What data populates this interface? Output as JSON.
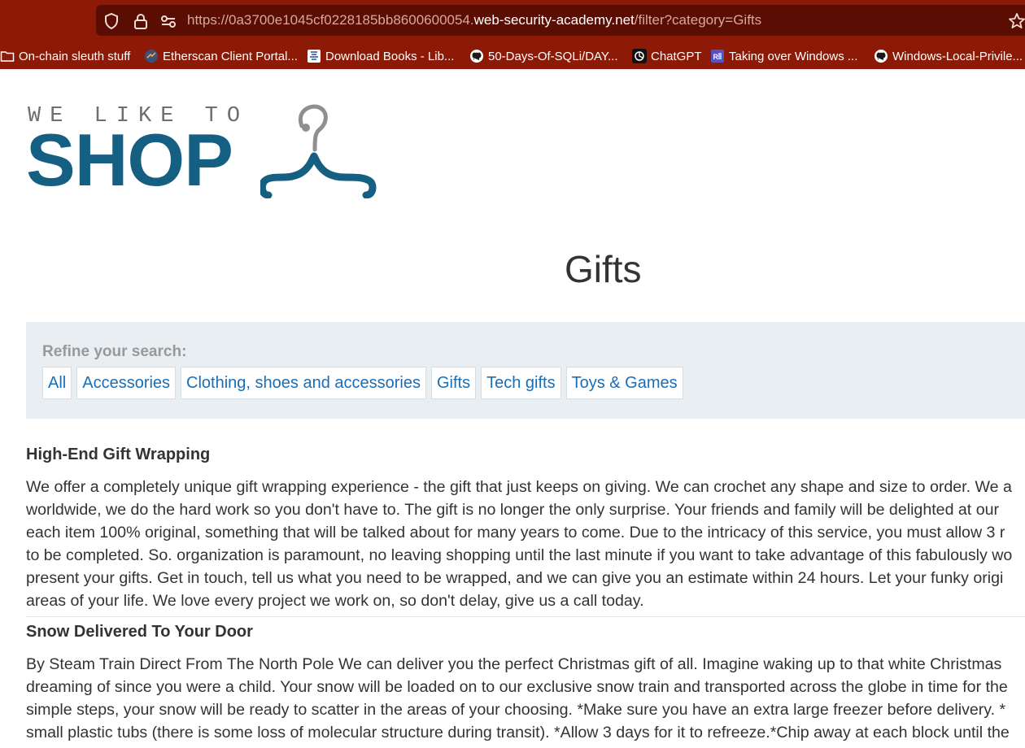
{
  "browser": {
    "url": {
      "prefix": "https://0a3700e1045cf0228185bb8600600054.",
      "host": "web-security-academy.net",
      "path": "/filter?category=Gifts"
    },
    "bookmarks": [
      {
        "label": "On-chain sleuth stuff",
        "icon": "folder-icon"
      },
      {
        "label": "Etherscan Client Portal...",
        "icon": "etherscan-icon"
      },
      {
        "label": "Download Books - Lib...",
        "icon": "library-icon"
      },
      {
        "label": "50-Days-Of-SQLi/DAY...",
        "icon": "github-icon"
      },
      {
        "label": "ChatGPT",
        "icon": "chatgpt-icon"
      },
      {
        "label": "Taking over Windows ...",
        "icon": "article-icon"
      },
      {
        "label": "Windows-Local-Privile...",
        "icon": "github-icon"
      }
    ],
    "colors": {
      "chrome": "#8c1a06",
      "url_bar": "#5a0d03"
    }
  },
  "logo": {
    "tagline": "WE LIKE TO",
    "wordmark": "SHOP",
    "icon": "hanger-icon",
    "color": "#155f82"
  },
  "page": {
    "title": "Gifts"
  },
  "filter": {
    "label": "Refine your search:",
    "links": [
      "All",
      "Accessories",
      "Clothing, shoes and accessories",
      "Gifts",
      "Tech gifts",
      "Toys & Games"
    ],
    "link_color": "#1a6eb5",
    "panel_color": "#e8eef1"
  },
  "products": [
    {
      "title": "High-End Gift Wrapping",
      "lines": [
        "We offer a completely unique gift wrapping experience - the gift that just keeps on giving. We can crochet any shape and size to order. We a",
        "worldwide, we do the hard work so you don't have to. The gift is no longer the only surprise. Your friends and family will be delighted at our",
        "each item 100% original, something that will be talked about for many years to come. Due to the intricacy of this service, you must allow 3 r",
        "to be completed. So. organization is paramount, no leaving shopping until the last minute if you want to take advantage of this fabulously wo",
        "present your gifts. Get in touch, tell us what you need to be wrapped, and we can give you an estimate within 24 hours. Let your funky origi",
        "areas of your life. We love every project we work on, so don't delay, give us a call today."
      ]
    },
    {
      "title": "Snow Delivered To Your Door",
      "lines": [
        "By Steam Train Direct From The North Pole We can deliver you the perfect Christmas gift of all. Imagine waking up to that white Christmas",
        "dreaming of since you were a child. Your snow will be loaded on to our exclusive snow train and transported across the globe in time for the",
        "simple steps, your snow will be ready to scatter in the areas of your choosing. *Make sure you have an extra large freezer before delivery. *",
        "small plastic tubs (there is some loss of molecular structure during transit). *Allow 3 days for it to refreeze.*Chip away at each block until the"
      ]
    }
  ]
}
